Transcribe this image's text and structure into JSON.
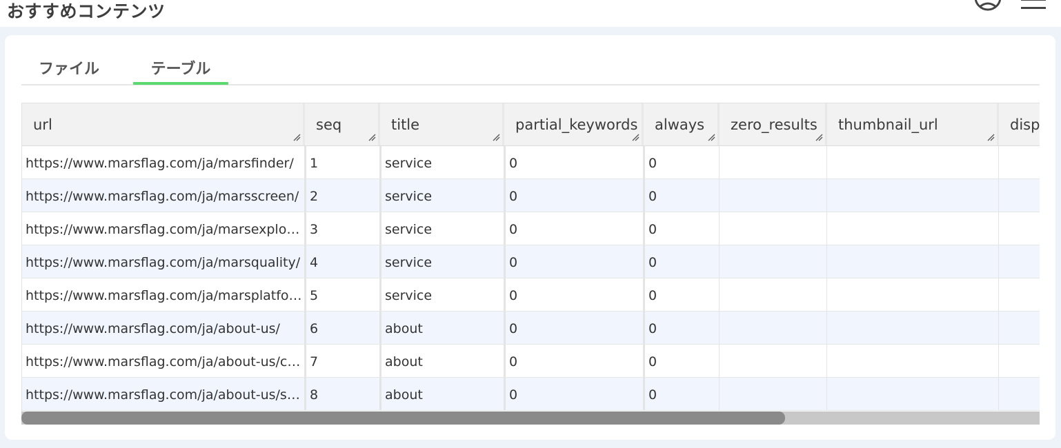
{
  "header": {
    "title": "おすすめコンテンツ",
    "user_icon": "user-circle-icon",
    "menu_icon": "hamburger-menu-icon"
  },
  "tabs": [
    {
      "label": "ファイル",
      "active": false
    },
    {
      "label": "テーブル",
      "active": true
    }
  ],
  "colors": {
    "tab_active_underline": "#5ad96e",
    "row_alt": "#f1f6fe",
    "header_bg": "#f2f2f2",
    "scroll_thumb": "#8a8a8a"
  },
  "table": {
    "columns": [
      "url",
      "seq",
      "title",
      "partial_keywords",
      "always",
      "zero_results",
      "thumbnail_url",
      "disp"
    ],
    "rows": [
      [
        "https://www.marsflag.com/ja/marsfinder/",
        "1",
        "service",
        "0",
        "0",
        "",
        "",
        ""
      ],
      [
        "https://www.marsflag.com/ja/marsscreen/",
        "2",
        "service",
        "0",
        "0",
        "",
        "",
        ""
      ],
      [
        "https://www.marsflag.com/ja/marsexplorer/",
        "3",
        "service",
        "0",
        "0",
        "",
        "",
        ""
      ],
      [
        "https://www.marsflag.com/ja/marsquality/",
        "4",
        "service",
        "0",
        "0",
        "",
        "",
        ""
      ],
      [
        "https://www.marsflag.com/ja/marsplatform/",
        "5",
        "service",
        "0",
        "0",
        "",
        "",
        ""
      ],
      [
        "https://www.marsflag.com/ja/about-us/",
        "6",
        "about",
        "0",
        "0",
        "",
        "",
        ""
      ],
      [
        "https://www.marsflag.com/ja/about-us/care…",
        "7",
        "about",
        "0",
        "0",
        "",
        "",
        ""
      ],
      [
        "https://www.marsflag.com/ja/about-us/staff/",
        "8",
        "about",
        "0",
        "0",
        "",
        "",
        ""
      ]
    ]
  },
  "scrollbar": {
    "horizontal_visible_fraction": 0.75
  }
}
